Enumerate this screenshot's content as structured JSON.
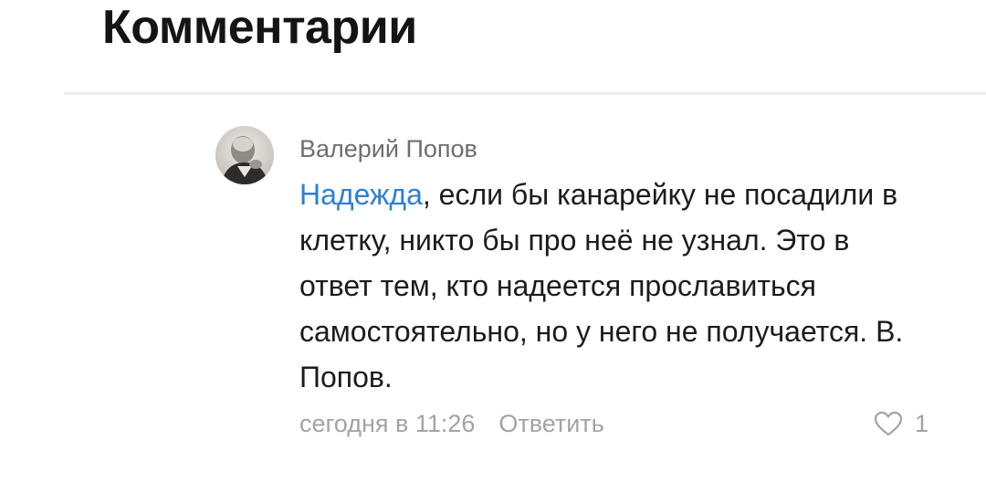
{
  "section": {
    "title": "Комментарии"
  },
  "comment": {
    "author": "Валерий Попов",
    "mention": "Надежда",
    "text": ", если бы канарейку не посадили в клетку, никто бы про неё не узнал. Это в ответ тем, кто надеется прославиться самостоятельно, но у него не получается. В. Попов.",
    "time": "сегодня в 11:26",
    "reply_label": "Ответить",
    "likes": "1"
  },
  "colors": {
    "mention": "#2f7fd0",
    "muted": "#a3a3a3",
    "author": "#6e6e6e"
  },
  "icons": {
    "like": "heart-outline-icon"
  }
}
